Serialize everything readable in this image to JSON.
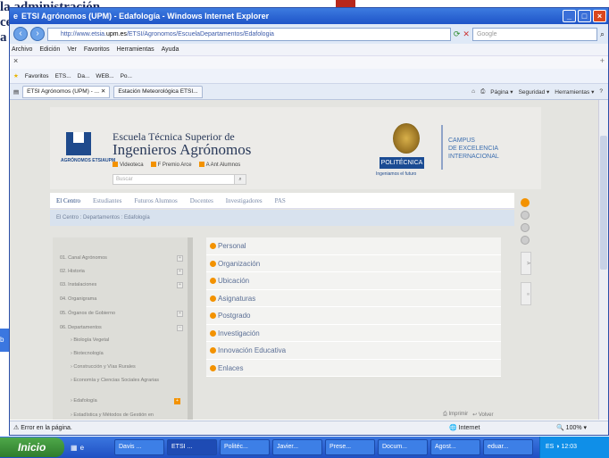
{
  "slide": {
    "text_lines": [
      "la administración",
      "",
      "ce",
      "a"
    ],
    "arrow_color": "#b8281c"
  },
  "window": {
    "title": "ETSI Agrónomos (UPM) - Edafología - Windows Internet Explorer",
    "url_prefix": "http://www.etsia.",
    "url_bold": "upm.es",
    "url_suffix": "/ETSI/Agronomos/EscuelaDepartamentos/Edafologia",
    "search_placeholder": "Google",
    "menu": [
      "Archivo",
      "Edición",
      "Ver",
      "Favoritos",
      "Herramientas",
      "Ayuda"
    ],
    "x_label": "×",
    "favorites": [
      "Favoritos",
      "ETS...",
      "Da...",
      "WEB...",
      "Po..."
    ],
    "tabs": [
      "ETSI Agrónomos (UPM) - ...",
      "Estación Meteorológica ETSI..."
    ],
    "tools": [
      "Página ▾",
      "Seguridad ▾",
      "Herramientas ▾"
    ]
  },
  "page": {
    "logo_text": "AGRÓNOMOS ETSIAUPM",
    "school_line1": "Escuela Técnica Superior de",
    "school_line2": "Ingenieros Agrónomos",
    "header_links": [
      "Videoteca",
      "F Premio Arce",
      "A Ant Alumnos"
    ],
    "search_placeholder": "Buscar",
    "upm_label": "POLITÉCNICA",
    "upm_sub": "Ingeniamos el futuro",
    "campus": [
      "CAMPUS",
      "DE EXCELENCIA",
      "INTERNACIONAL"
    ],
    "nav": [
      "El Centro",
      "Estudiantes",
      "Futuros Alumnos",
      "Docentes",
      "Investigadores",
      "PAS"
    ],
    "breadcrumb": "El Centro : Departamentos : Edafología",
    "side_items": [
      {
        "label": "01. Canal Agrónomos",
        "sub": false
      },
      {
        "label": "02. Historia",
        "sub": false
      },
      {
        "label": "03. Instalaciones",
        "sub": false
      },
      {
        "label": "04. Organigrama",
        "sub": false
      },
      {
        "label": "05. Órganos de Gobierno",
        "sub": false
      },
      {
        "label": "06. Departamentos",
        "sub": false
      },
      {
        "label": "Biología Vegetal",
        "sub": true
      },
      {
        "label": "Biotecnología",
        "sub": true
      },
      {
        "label": "Construcción y Vías Rurales",
        "sub": true
      },
      {
        "label": "Economía y Ciencias Sociales Agrarias",
        "sub": true
      },
      {
        "label": "Edafología",
        "sub": true
      },
      {
        "label": "Estadística y Métodos de Gestión en",
        "sub": true
      }
    ],
    "main_items": [
      "Personal",
      "Organización",
      "Ubicación",
      "Asignaturas",
      "Postgrado",
      "Investigación",
      "Innovación Educativa",
      "Enlaces"
    ],
    "footer_links": [
      "Imprimir",
      "Volver"
    ],
    "accent": "#f39200"
  },
  "status": {
    "left": "Error en la página.",
    "middle": "Internet",
    "zoom": "100%"
  },
  "taskbar": {
    "start": "Inicio",
    "tasks": [
      "Davis ...",
      "ETSI ...",
      "Politéc...",
      "Javier...",
      "Prese...",
      "Docum...",
      "Agost...",
      "eduar..."
    ],
    "tray_lang": "ES",
    "clock": "12:03"
  }
}
